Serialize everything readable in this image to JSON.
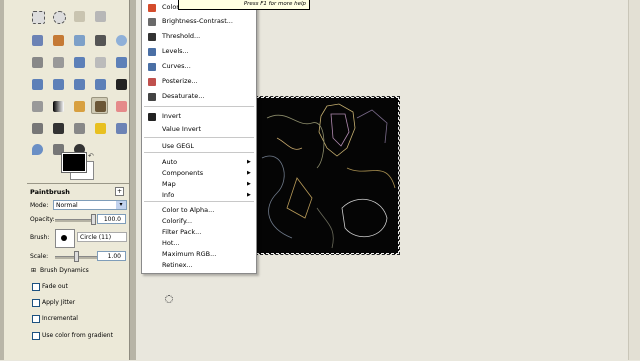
{
  "tooltip": {
    "text": "Press F1 for more help"
  },
  "menu": {
    "items": [
      {
        "label": "Color Balance...",
        "icon": "color-balance-icon",
        "color": "#d44c2c"
      },
      {
        "label": "Brightness-Contrast...",
        "icon": "brightness-contrast-icon",
        "color": "#6a6a6a"
      },
      {
        "label": "Threshold...",
        "icon": "threshold-icon",
        "color": "#333333"
      },
      {
        "label": "Levels...",
        "icon": "levels-icon",
        "color": "#4a6fa5"
      },
      {
        "label": "Curves...",
        "icon": "curves-icon",
        "color": "#4a6fa5"
      },
      {
        "label": "Posterize...",
        "icon": "posterize-icon",
        "color": "#c0504d"
      },
      {
        "label": "Desaturate...",
        "icon": "desaturate-icon",
        "color": "#444444"
      },
      {
        "label": "Invert",
        "icon": "invert-icon",
        "color": "#222222"
      },
      {
        "label": "Value Invert",
        "icon": "",
        "color": ""
      },
      {
        "label": "Use GEGL",
        "icon": "",
        "color": ""
      },
      {
        "label": "Auto",
        "icon": "",
        "color": ""
      },
      {
        "label": "Components",
        "icon": "",
        "color": ""
      },
      {
        "label": "Map",
        "icon": "",
        "color": ""
      },
      {
        "label": "Info",
        "icon": "",
        "color": ""
      },
      {
        "label": "Color to Alpha...",
        "icon": "",
        "color": ""
      },
      {
        "label": "Colorify...",
        "icon": "",
        "color": ""
      },
      {
        "label": "Filter Pack...",
        "icon": "",
        "color": ""
      },
      {
        "label": "Hot...",
        "icon": "",
        "color": ""
      },
      {
        "label": "Maximum RGB...",
        "icon": "",
        "color": ""
      },
      {
        "label": "Retinex...",
        "icon": "",
        "color": ""
      }
    ],
    "submenu_arrow": "▶"
  },
  "tool_options": {
    "title": "Paintbrush",
    "mode_label": "Mode:",
    "mode_value": "Normal",
    "opacity_label": "Opacity:",
    "opacity_value": "100.0",
    "brush_label": "Brush:",
    "brush_value": "Circle (11)",
    "scale_label": "Scale:",
    "scale_value": "1.00",
    "brush_dynamics_label": "Brush Dynamics",
    "fade_out_label": "Fade out",
    "apply_jitter_label": "Apply Jitter",
    "incremental_label": "Incremental",
    "use_color_gradient_label": "Use color from gradient",
    "combo_arrow": "▾",
    "expander_sign": "⊞",
    "panel_plus": "+"
  },
  "colors": {
    "foreground": "#000000",
    "background": "#ffffff",
    "swap_glyph": "↶"
  }
}
